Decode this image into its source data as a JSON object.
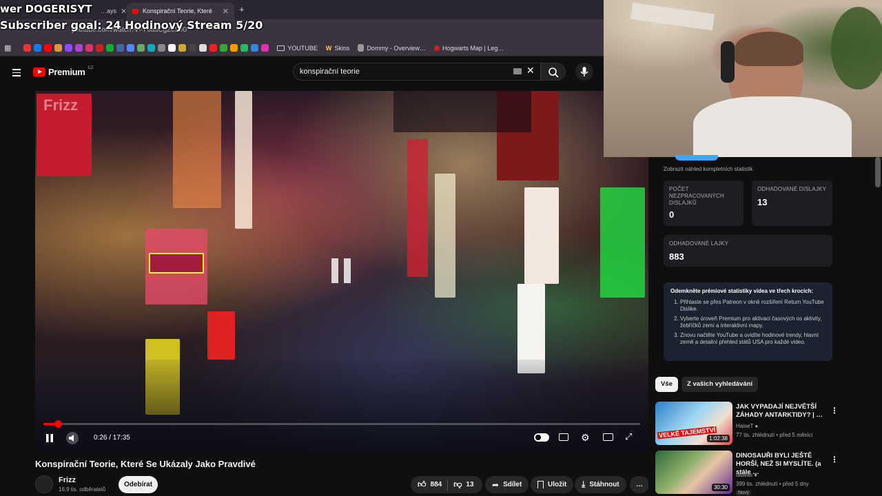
{
  "browser": {
    "tabs": [
      {
        "label": "…ays",
        "active": false
      },
      {
        "label": "Konspirační Teorie, Které Se …",
        "active": true
      }
    ],
    "new_tab": "+",
    "url": "youtube.com/watch?v=Y6asCgZcS60",
    "bookmarks": [
      {
        "label": "YOUTUBE",
        "type": "folder"
      },
      {
        "label": "Skins",
        "icon_letter": "W"
      },
      {
        "label": "Dommy - Overview…"
      },
      {
        "label": "Hogwarts Map | Leg…"
      }
    ]
  },
  "stream_overlay": {
    "line1": "wer DOGERISYT",
    "line2": "Subscriber goal: 24 Hodinový Stream 5/20"
  },
  "youtube": {
    "logo_text": "Premium",
    "logo_region": "CZ",
    "search": {
      "value": "konspirační teorie"
    },
    "player": {
      "watermark": "Frizz",
      "time": "0:26 / 17:35",
      "progress": 0.0247
    },
    "video": {
      "title": "Konspirační Teorie, Které Se Ukázaly Jako Pravdivé",
      "channel": "Frizz",
      "subscribers": "16,9 tis. odběratelů",
      "subscribe_label": "Odebírat",
      "likes": "884",
      "dislikes": "13",
      "share": "Sdílet",
      "save": "Uložit",
      "download": "Stáhnout",
      "more": "…"
    },
    "dislike_panel": {
      "view_stats": "Zobrazit náhled kompletních statistik",
      "cards": [
        {
          "label": "POČET NEZPRACOVANÝCH DISLAJKŮ",
          "value": "0"
        },
        {
          "label": "ODHADOVANÉ DISLAJKY",
          "value": "13"
        },
        {
          "label": "ODHADOVANÉ LAJKY",
          "value": "883"
        }
      ],
      "premium_title": "Odemkněte prémiové statistiky videa ve třech krocích:",
      "premium_steps": [
        "Přihlaste se přes Patreon v okně rozšíření Return YouTube Dislike.",
        "Vyberte úroveň Premium pro aktivaci časových os aktivity, žebříčků zemí a interaktivní mapy.",
        "Znovu načtěte YouTube a uvidíte hodinové trendy, hlavní země a detailní přehled států USA pro každé video."
      ]
    },
    "chips": [
      "Vše",
      "Z vašich vyhledávání"
    ],
    "recommendations": [
      {
        "title": "JAK VYPADAJÍ NEJVĚTŠÍ ZÁHADY ANTARKTIDY? | …",
        "channel": "HaiseT",
        "meta": "77 tis. zhlédnutí • před 5 měsíci",
        "duration": "1:02:38",
        "thumb_text": "VELKÉ TAJEMSTVÍ"
      },
      {
        "title": "DINOSAUŘI BYLI JEŠTĚ HORŠÍ, NEŽ SI MYSLÍTE. (a stále …",
        "channel": "tadeas",
        "meta": "399 tis. zhlédnutí • před 5 dny",
        "badge": "Nový",
        "duration": "30:30"
      }
    ]
  },
  "colors": {
    "accent": "#ff0000",
    "background": "#0f0f0f",
    "panel": "#1e1e22"
  }
}
